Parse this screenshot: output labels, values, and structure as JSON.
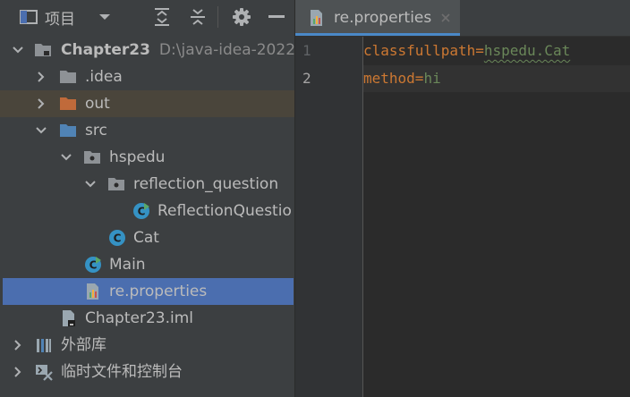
{
  "project_panel": {
    "title": "项目",
    "tree": [
      {
        "label": "Chapter23",
        "path": "D:\\java-idea-2022."
      },
      {
        "label": ".idea"
      },
      {
        "label": "out"
      },
      {
        "label": "src"
      },
      {
        "label": "hspedu"
      },
      {
        "label": "reflection_question"
      },
      {
        "label": "ReflectionQuestio"
      },
      {
        "label": "Cat"
      },
      {
        "label": "Main"
      },
      {
        "label": "re.properties"
      },
      {
        "label": "Chapter23.iml"
      },
      {
        "label": "外部库"
      },
      {
        "label": "临时文件和控制台"
      }
    ]
  },
  "editor": {
    "tab_label": "re.properties",
    "lines": [
      {
        "number": "1",
        "key": "classfullpath",
        "eq": "=",
        "value": "hspedu.Cat"
      },
      {
        "number": "2",
        "key": "method",
        "eq": "=",
        "value": "hi"
      }
    ]
  },
  "colors": {
    "accent": "#4b6eaf",
    "key": "#cc7832",
    "value": "#6a8759",
    "folder_blue": "#5083b5",
    "folder_orange": "#c06a3a"
  }
}
